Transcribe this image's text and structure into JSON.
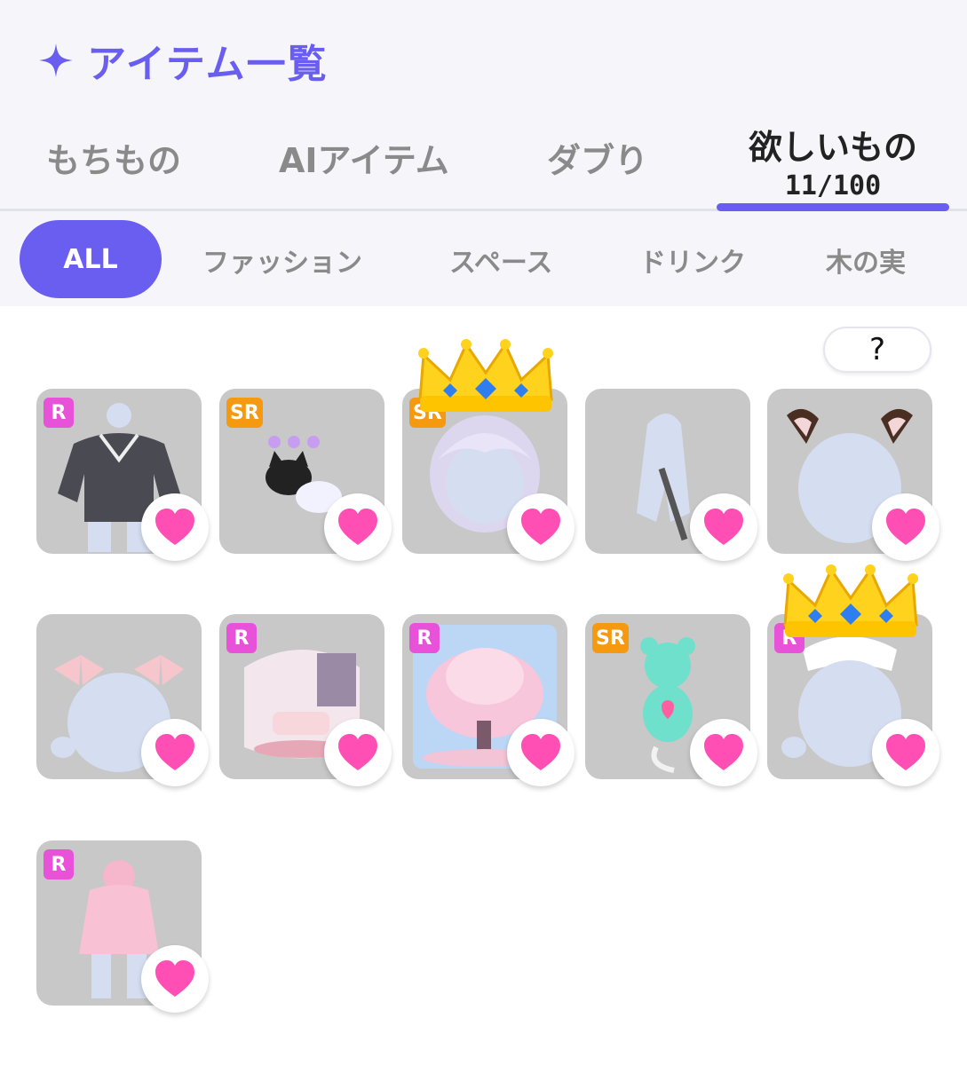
{
  "header": {
    "title": "アイテム一覧",
    "icon": "sparkle-icon",
    "accent_color": "#6a5ef0"
  },
  "tabs": [
    {
      "label": "もちもの"
    },
    {
      "label": "AIアイテム"
    },
    {
      "label": "ダブり"
    },
    {
      "label": "欲しいもの",
      "count": "11/100",
      "active": true
    }
  ],
  "filters": [
    {
      "label": "ALL",
      "active": true
    },
    {
      "label": "ファッション"
    },
    {
      "label": "スペース"
    },
    {
      "label": "ドリンク"
    },
    {
      "label": "木の実"
    }
  ],
  "help": {
    "label": "?"
  },
  "items": [
    {
      "rarity": "R",
      "kind": "gray-sweater-outfit",
      "wished": true
    },
    {
      "rarity": "SR",
      "kind": "black-cat-white-cloud-pets",
      "wished": true
    },
    {
      "rarity": "SR",
      "kind": "silver-short-hair",
      "wished": true,
      "crowned": true
    },
    {
      "rarity": "",
      "kind": "blue-cape-with-sword",
      "wished": true
    },
    {
      "rarity": "",
      "kind": "brown-animal-ears",
      "wished": true
    },
    {
      "rarity": "",
      "kind": "pink-plaid-ribbons",
      "wished": true
    },
    {
      "rarity": "R",
      "kind": "pink-room-space",
      "wished": true
    },
    {
      "rarity": "R",
      "kind": "cherry-blossom-tree-space",
      "wished": true
    },
    {
      "rarity": "SR",
      "kind": "mint-bear-plush",
      "wished": true
    },
    {
      "rarity": "R",
      "kind": "nurse-cap-headwear",
      "wished": true,
      "crowned": true
    },
    {
      "rarity": "R",
      "kind": "pink-raincoat-outfit",
      "wished": true
    }
  ],
  "colors": {
    "heart": "#ff4fb4",
    "rarity_r": "#e852d8",
    "rarity_sr": "#f59a10",
    "card": "#c8c8c8"
  }
}
